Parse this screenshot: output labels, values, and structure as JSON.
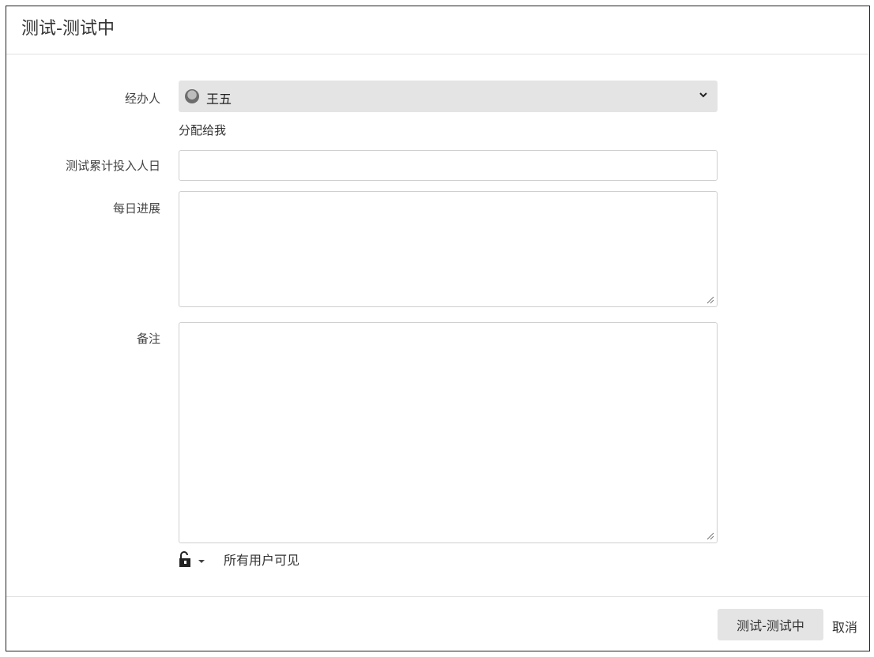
{
  "dialog": {
    "title": "测试-测试中"
  },
  "form": {
    "assignee": {
      "label": "经办人",
      "value": "王五",
      "avatar_icon": "user-avatar-icon",
      "assign_to_me": "分配给我"
    },
    "effort": {
      "label": "测试累计投入人日",
      "value": ""
    },
    "progress": {
      "label": "每日进展",
      "value": ""
    },
    "comment": {
      "label": "备注",
      "value": "",
      "security": {
        "lock_icon": "unlock-icon",
        "visibility": "所有用户可见"
      }
    }
  },
  "footer": {
    "submit_label": "测试-测试中",
    "cancel_label": "取消"
  }
}
